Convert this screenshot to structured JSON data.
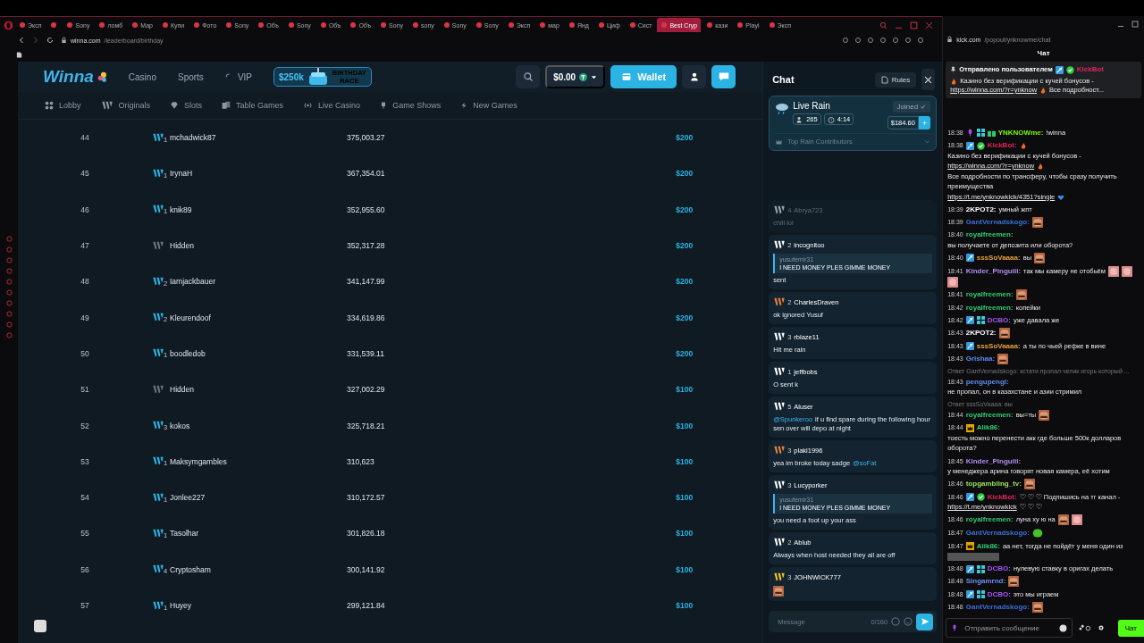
{
  "browser": {
    "tabs": [
      {
        "label": "Эксп",
        "selected": false
      },
      {
        "selected": false
      },
      {
        "label": "Sony",
        "selected": false
      },
      {
        "label": "ломб",
        "selected": false
      },
      {
        "label": "Мар",
        "selected": false
      },
      {
        "label": "Купи",
        "selected": false
      },
      {
        "label": "Фото",
        "selected": false
      },
      {
        "label": "Sony",
        "selected": false
      },
      {
        "label": "Объ",
        "selected": false
      },
      {
        "label": "Sony",
        "selected": false
      },
      {
        "label": "Объ",
        "selected": false
      },
      {
        "label": "Объ",
        "selected": false
      },
      {
        "label": "Sony",
        "selected": false
      },
      {
        "label": "sony",
        "selected": false
      },
      {
        "label": "Sony",
        "selected": false
      },
      {
        "label": "Sony",
        "selected": false
      },
      {
        "label": "Эксп",
        "selected": false
      },
      {
        "label": "мар",
        "selected": false
      },
      {
        "label": "Янд",
        "selected": false
      },
      {
        "label": "Циф",
        "selected": false
      },
      {
        "label": "Сист",
        "selected": false
      },
      {
        "label": "Best Cryp",
        "selected": true
      },
      {
        "label": "кази",
        "selected": false
      },
      {
        "label": "Playi",
        "selected": false
      },
      {
        "label": "Эксп",
        "selected": false
      }
    ],
    "address": {
      "host": "winna.com",
      "path": "/leaderboard/birthday"
    }
  },
  "site": {
    "logo": "Winna",
    "nav": [
      "Casino",
      "Sports",
      "VIP"
    ],
    "promo": {
      "amount": "$250k",
      "line1": "BIRTHDAY",
      "line2": "RACE"
    },
    "balance": "$0.00",
    "wallet": "Wallet",
    "categories": [
      {
        "kind": "lobby",
        "label": "Lobby"
      },
      {
        "kind": "originals",
        "label": "Originals"
      },
      {
        "kind": "slots",
        "label": "Slots"
      },
      {
        "kind": "table",
        "label": "Table Games"
      },
      {
        "kind": "live",
        "label": "Live Casino"
      },
      {
        "kind": "shows",
        "label": "Game Shows"
      },
      {
        "kind": "new",
        "label": "New Games"
      }
    ],
    "leaderboard": {
      "rows": [
        {
          "rank": "44",
          "tier": "1",
          "name": "mchadwick87",
          "wagered": "375,003.27",
          "prize": "$200"
        },
        {
          "rank": "45",
          "tier": "1",
          "name": "IrynaH",
          "wagered": "367,354.01",
          "prize": "$200"
        },
        {
          "rank": "46",
          "tier": "1",
          "name": "knik89",
          "wagered": "352,955.60",
          "prize": "$200"
        },
        {
          "rank": "47",
          "name": "Hidden",
          "wagered": "352,317.28",
          "prize": "$200"
        },
        {
          "rank": "48",
          "tier": "2",
          "name": "Iamjackbauer",
          "wagered": "341,147.99",
          "prize": "$200"
        },
        {
          "rank": "49",
          "tier": "2",
          "name": "Kleurendoof",
          "wagered": "334,619.86",
          "prize": "$200"
        },
        {
          "rank": "50",
          "tier": "1",
          "name": "boodledob",
          "wagered": "331,539.11",
          "prize": "$200"
        },
        {
          "rank": "51",
          "name": "Hidden",
          "wagered": "327,002.29",
          "prize": "$100"
        },
        {
          "rank": "52",
          "tier": "3",
          "name": "kokos",
          "wagered": "325,718.21",
          "prize": "$100"
        },
        {
          "rank": "53",
          "tier": "1",
          "name": "Maksymgambles",
          "wagered": "310,623",
          "prize": "$100"
        },
        {
          "rank": "54",
          "tier": "1",
          "name": "Jonlee227",
          "wagered": "310,172.57",
          "prize": "$100"
        },
        {
          "rank": "55",
          "tier": "1",
          "name": "Tasolhar",
          "wagered": "301,826.18",
          "prize": "$100"
        },
        {
          "rank": "56",
          "tier": "4",
          "name": "Cryptosham",
          "wagered": "300,141.92",
          "prize": "$100"
        },
        {
          "rank": "57",
          "tier": "1",
          "name": "Huyey",
          "wagered": "299,121.84",
          "prize": "$100"
        }
      ]
    },
    "chat": {
      "title": "Chat",
      "rules": "Rules",
      "rain": {
        "title": "Live Rain",
        "users": "265",
        "timer": "4:14",
        "joined": "Joined",
        "amount": "$184.60",
        "plus": "+",
        "contributors": "Top Rain Contributors"
      },
      "messages": [
        {
          "user": "Abrya723",
          "tier": "4",
          "color": "#9aa5ad",
          "dimmed": true,
          "body": [
            {
              "kind": "text",
              "text": "chill lol"
            }
          ]
        },
        {
          "user": "incognitoo",
          "tier": "2",
          "color": "#ffffff",
          "dimmed": false,
          "reply": {
            "user": "yusufemir31",
            "text": "I NEED MONEY PLES GIMME MONEY"
          },
          "body": [
            {
              "kind": "text",
              "text": "sent"
            }
          ]
        },
        {
          "user": "CharlesDraven",
          "tier": "2",
          "color": "#e8823a",
          "dimmed": false,
          "body": [
            {
              "kind": "text",
              "text": "ok ignored Yusuf"
            }
          ]
        },
        {
          "user": "rblaze11",
          "tier": "3",
          "color": "#ffffff",
          "dimmed": false,
          "body": [
            {
              "kind": "text",
              "text": "Hit me rain"
            }
          ]
        },
        {
          "user": "jeffbobs",
          "tier": "1",
          "color": "#ffffff",
          "dimmed": false,
          "body": [
            {
              "kind": "text",
              "text": "O sent k"
            }
          ]
        },
        {
          "user": "Aluser",
          "tier": "5",
          "color": "#ffffff",
          "dimmed": false,
          "body": [
            {
              "kind": "mention",
              "text": "@Spunkeroo"
            },
            {
              "kind": "text",
              "text": "if u find spare during the following hour sen over will depo at night"
            }
          ]
        },
        {
          "user": "plakl1996",
          "tier": "3",
          "color": "#e8823a",
          "dimmed": false,
          "body": [
            {
              "kind": "text",
              "text": "yea im broke today sadge"
            },
            {
              "kind": "mention",
              "text": "@soFat"
            }
          ]
        },
        {
          "user": "Lucyporker",
          "tier": "3",
          "color": "#ffffff",
          "dimmed": false,
          "reply": {
            "user": "yusufemir31",
            "text": "I NEED MONEY PLES GIMME MONEY"
          },
          "body": [
            {
              "kind": "text",
              "text": "you need a foot up your ass"
            }
          ]
        },
        {
          "user": "Ablub",
          "tier": "2",
          "color": "#ffffff",
          "dimmed": false,
          "body": [
            {
              "kind": "text",
              "text": "Always when host needed they all are off"
            }
          ]
        },
        {
          "user": "JOHNWICK777",
          "tier": "3",
          "color": "#f0c419",
          "dimmed": false,
          "body": [
            {
              "kind": "emote"
            }
          ]
        }
      ],
      "input": {
        "placeholder": "Message",
        "counter": "0/160"
      }
    }
  },
  "kick": {
    "address": {
      "host": "kick.com",
      "path": "/popout/ynknowme/chat"
    },
    "title": "Чат",
    "pinned": {
      "label": "Отправлено пользователем",
      "user": "KickBot",
      "color": "#e0245e",
      "body": [
        {
          "kind": "fire"
        },
        {
          "kind": "text",
          "text": "Казино без верификации с кучей бонусов -"
        },
        {
          "kind": "link",
          "text": "https://winna.com/?r=ynknow"
        },
        {
          "kind": "fire"
        },
        {
          "kind": "text",
          "text": "Все подробност..."
        }
      ]
    },
    "messages": [
      {
        "time": "18:38",
        "badges": [
          {
            "kind": "mic"
          },
          {
            "kind": "sub"
          },
          {
            "kind": "gift"
          }
        ],
        "user": "YNKNOWme:",
        "color": "#7cfc00",
        "body": [
          {
            "kind": "text",
            "text": "!winna"
          }
        ]
      },
      {
        "time": "18:38",
        "badges": [
          {
            "kind": "mod"
          },
          {
            "kind": "verified"
          }
        ],
        "user": "KickBot:",
        "color": "#e0245e",
        "body": [
          {
            "kind": "fire"
          },
          {
            "kind": "text",
            "text": "Казино без верификации с кучей бонусов -"
          },
          {
            "kind": "link",
            "text": "https://winna.com/?r=ynknow"
          },
          {
            "kind": "fire"
          },
          {
            "kind": "text",
            "text": "Все подробности по трансферу, чтобы сразу получить преимущества"
          },
          {
            "kind": "link",
            "text": "https://t.me/ynknowkick/4351?single"
          },
          {
            "kind": "heart"
          }
        ]
      },
      {
        "time": "18:39",
        "user": "2KPOT2:",
        "color": "#ffffff",
        "body": [
          {
            "kind": "text",
            "text": "умный жпт"
          }
        ]
      },
      {
        "time": "18:39",
        "user": "GantVernadskogo:",
        "color": "#3a6fd8",
        "body": [
          {
            "kind": "emote"
          }
        ]
      },
      {
        "time": "18:40",
        "user": "royalfreemen:",
        "color": "#2ecc71",
        "body": [
          {
            "kind": "text",
            "text": "вы получаете от депозита или оборота?"
          }
        ]
      },
      {
        "time": "18:40",
        "badges": [
          {
            "kind": "mod"
          }
        ],
        "user": "sssSoVaaaa:",
        "color": "#e6a23c",
        "body": [
          {
            "kind": "text",
            "text": "вы"
          },
          {
            "kind": "emote"
          }
        ]
      },
      {
        "time": "18:41",
        "user": "Kinder_Pinguiii:",
        "color": "#b48cf0",
        "body": [
          {
            "kind": "text",
            "text": "так мы камеру не отобьём"
          },
          {
            "kind": "pink-emote"
          },
          {
            "kind": "pink-emote"
          },
          {
            "kind": "pink-emote"
          }
        ]
      },
      {
        "time": "18:41",
        "user": "royalfreemen:",
        "color": "#2ecc71",
        "body": [
          {
            "kind": "emote"
          }
        ]
      },
      {
        "time": "18:42",
        "user": "royalfreemen:",
        "color": "#2ecc71",
        "body": [
          {
            "kind": "text",
            "text": "копейки"
          }
        ]
      },
      {
        "time": "18:42",
        "badges": [
          {
            "kind": "mod"
          },
          {
            "kind": "sub"
          }
        ],
        "user": "DCBO:",
        "color": "#a855f7",
        "body": [
          {
            "kind": "text",
            "text": "уже давала же"
          }
        ]
      },
      {
        "time": "18:43",
        "user": "2KPOT2:",
        "color": "#ffffff",
        "body": [
          {
            "kind": "emote"
          }
        ]
      },
      {
        "time": "18:43",
        "badges": [
          {
            "kind": "mod"
          }
        ],
        "user": "sssSoVaaaa:",
        "color": "#e6a23c",
        "body": [
          {
            "kind": "text",
            "text": "а ты по чьей рефке в вине"
          }
        ]
      },
      {
        "time": "18:43",
        "user": "Grishaa:",
        "color": "#5b8def",
        "body": [
          {
            "kind": "emote"
          }
        ]
      },
      {
        "reply": "Ответ GantVernadskogo: кстати пропал челик игорь который ...",
        "time": "18:43",
        "user": "pengupengl:",
        "color": "#5b8def",
        "body": [
          {
            "kind": "text",
            "text": "не пропал, он в казахстане и азии стримил"
          }
        ]
      },
      {
        "reply": "Ответ sssSoVaaaa: вы",
        "time": "18:44",
        "user": "royalfreemen:",
        "color": "#2ecc71",
        "body": [
          {
            "kind": "text",
            "text": "вы=ты"
          },
          {
            "kind": "emote"
          }
        ]
      },
      {
        "time": "18:44",
        "badges": [
          {
            "kind": "crown"
          }
        ],
        "user": "Alik86:",
        "color": "#2ecc71",
        "body": [
          {
            "kind": "text",
            "text": "тоесть можно перенести акк где больше 500к долларов оборота?"
          }
        ]
      },
      {
        "time": "18:45",
        "user": "Kinder_Pinguiii:",
        "color": "#b48cf0",
        "body": [
          {
            "kind": "text",
            "text": "у менеджера арина говорят новая камера, её хотим"
          }
        ]
      },
      {
        "time": "18:46",
        "user": "topgambling_tv:",
        "color": "#9be15d",
        "body": [
          {
            "kind": "emote"
          }
        ]
      },
      {
        "time": "18:46",
        "badges": [
          {
            "kind": "mod"
          },
          {
            "kind": "verified"
          }
        ],
        "user": "KickBot:",
        "color": "#e0245e",
        "body": [
          {
            "kind": "text",
            "text": "♡ ♡ ♡ Подпишись на тг канал -"
          },
          {
            "kind": "link",
            "text": "https://t.me/ynknowkick"
          },
          {
            "kind": "text",
            "text": "♡ ♡ ♡"
          }
        ]
      },
      {
        "time": "18:46",
        "user": "royalfreemen:",
        "color": "#2ecc71",
        "body": [
          {
            "kind": "text",
            "text": "луна ху ю на"
          },
          {
            "kind": "emote"
          },
          {
            "kind": "pink-emote"
          }
        ]
      },
      {
        "time": "18:47",
        "user": "GantVernadskogo:",
        "color": "#3a6fd8",
        "body": [
          {
            "kind": "green-emote"
          }
        ]
      },
      {
        "time": "18:47",
        "badges": [
          {
            "kind": "crown"
          }
        ],
        "user": "Alik86:",
        "color": "#2ecc71",
        "body": [
          {
            "kind": "text",
            "text": "аа нет, тогда не пойдёт у меня один из"
          },
          {
            "kind": "spoiler"
          }
        ]
      },
      {
        "time": "18:48",
        "badges": [
          {
            "kind": "mod"
          },
          {
            "kind": "sub"
          }
        ],
        "user": "DCBO:",
        "color": "#a855f7",
        "body": [
          {
            "kind": "text",
            "text": "нулевую ставку в оригах делать"
          }
        ]
      },
      {
        "time": "18:48",
        "user": "Singamrnd:",
        "color": "#6f8cf5",
        "body": [
          {
            "kind": "emote"
          }
        ]
      },
      {
        "time": "18:48",
        "badges": [
          {
            "kind": "mod"
          },
          {
            "kind": "sub"
          }
        ],
        "user": "DCBO:",
        "color": "#a855f7",
        "body": [
          {
            "kind": "text",
            "text": "это мы играем"
          }
        ]
      },
      {
        "time": "18:48",
        "user": "GantVernadskogo:",
        "color": "#3a6fd8",
        "body": [
          {
            "kind": "emote"
          }
        ]
      }
    ],
    "input": {
      "placeholder": "Отправить сообщение",
      "send": "Чат"
    }
  }
}
